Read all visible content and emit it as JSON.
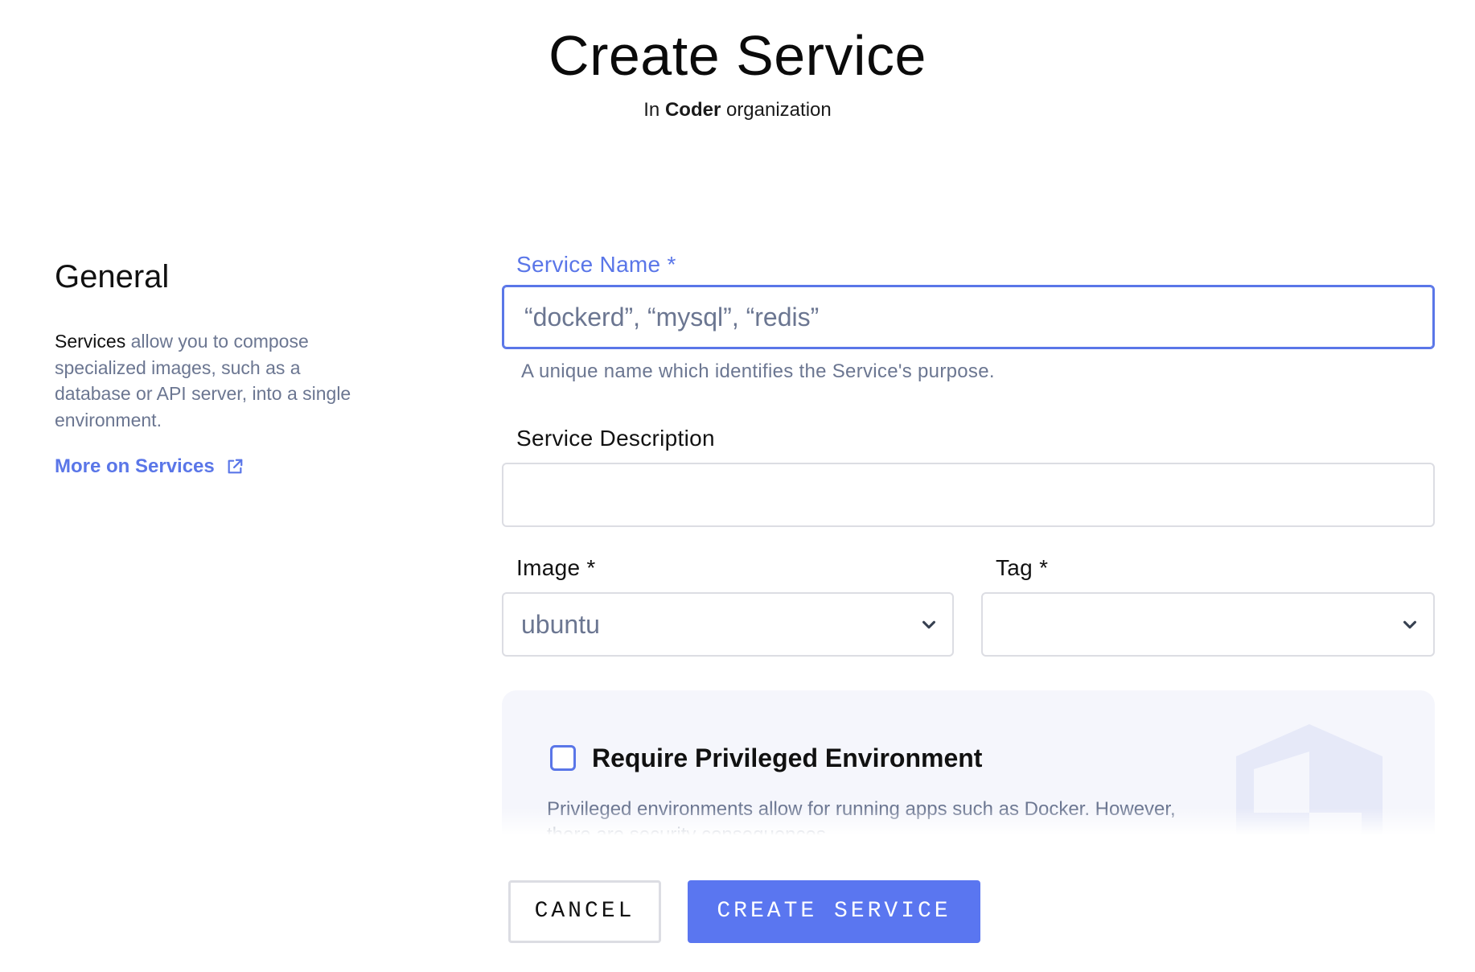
{
  "header": {
    "title": "Create Service",
    "subtitle_prefix": "In",
    "organization": "Coder",
    "subtitle_suffix": "organization"
  },
  "sidebar": {
    "title": "General",
    "description_lead": "Services",
    "description_rest": "allow you to compose specialized images, such as a database or API server, into a single environment.",
    "link_label": "More on Services",
    "link_icon": "external-link-icon"
  },
  "form": {
    "service_name": {
      "label": "Service Name",
      "required_mark": "*",
      "placeholder": "“dockerd”, “mysql”, “redis”",
      "value": "",
      "helper": "A unique name which identifies the Service's purpose."
    },
    "service_description": {
      "label": "Service Description",
      "value": ""
    },
    "image": {
      "label": "Image",
      "required_mark": "*",
      "selected": "ubuntu"
    },
    "tag": {
      "label": "Tag",
      "required_mark": "*",
      "selected": ""
    },
    "privileged": {
      "label": "Require Privileged Environment",
      "checked": false,
      "description": "Privileged environments allow for running apps such as Docker. However, there are security consequences."
    }
  },
  "actions": {
    "cancel_label": "CANCEL",
    "create_label": "CREATE SERVICE"
  },
  "colors": {
    "accent": "#5a76e8",
    "muted_text": "#6b7691",
    "border": "#dcdde3",
    "card_bg": "#f5f6fc"
  }
}
